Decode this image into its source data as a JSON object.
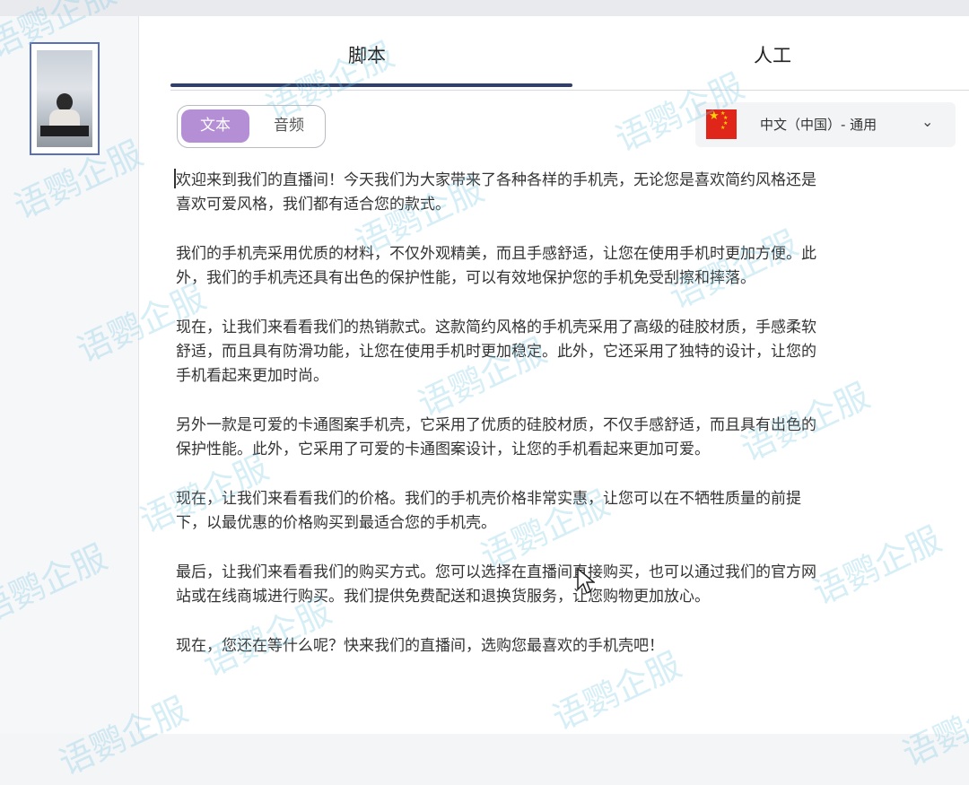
{
  "tabs": [
    {
      "label": "脚本"
    },
    {
      "label": "人工"
    }
  ],
  "mode_toggle": {
    "options": [
      "文本",
      "音频"
    ]
  },
  "language": {
    "selected": "中文（中国）- 通用",
    "flag": "china-flag-icon"
  },
  "script_text": [
    [
      "欢迎来到我们的直播间！今天我们为大家带来了各种各样的手机壳，无论您是喜欢简约风格还是",
      "喜欢可爱风格，我们都有适合您的款式。"
    ],
    [
      "我们的手机壳采用优质的材料，不仅外观精美，而且手感舒适，让您在使用手机时更加方便。此",
      "外，我们的手机壳还具有出色的保护性能，可以有效地保护您的手机免受刮擦和摔落。"
    ],
    [
      "现在，让我们来看看我们的热销款式。这款简约风格的手机壳采用了高级的硅胶材质，手感柔软",
      "舒适，而且具有防滑功能，让您在使用手机时更加稳定。此外，它还采用了独特的设计，让您的",
      "手机看起来更加时尚。"
    ],
    [
      "另外一款是可爱的卡通图案手机壳，它采用了优质的硅胶材质，不仅手感舒适，而且具有出色的",
      "保护性能。此外，它采用了可爱的卡通图案设计，让您的手机看起来更加可爱。"
    ],
    [
      "现在，让我们来看看我们的价格。我们的手机壳价格非常实惠，让您可以在不牺牲质量的前提",
      "下，以最优惠的价格购买到最适合您的手机壳。"
    ],
    [
      "最后，让我们来看看我们的购买方式。您可以选择在直播间直接购买，也可以通过我们的官方网",
      "站或在线商城进行购买。我们提供免费配送和退换货服务，让您购物更加放心。"
    ],
    [
      "现在，您还在等什么呢？快来我们的直播间，选购您最喜欢的手机壳吧！"
    ]
  ],
  "watermark": "语鹦企服",
  "colors": {
    "toggle_active": "#b48fd6",
    "tab_indicator": "#2f3f6e",
    "watermark": "#78c8e1"
  }
}
